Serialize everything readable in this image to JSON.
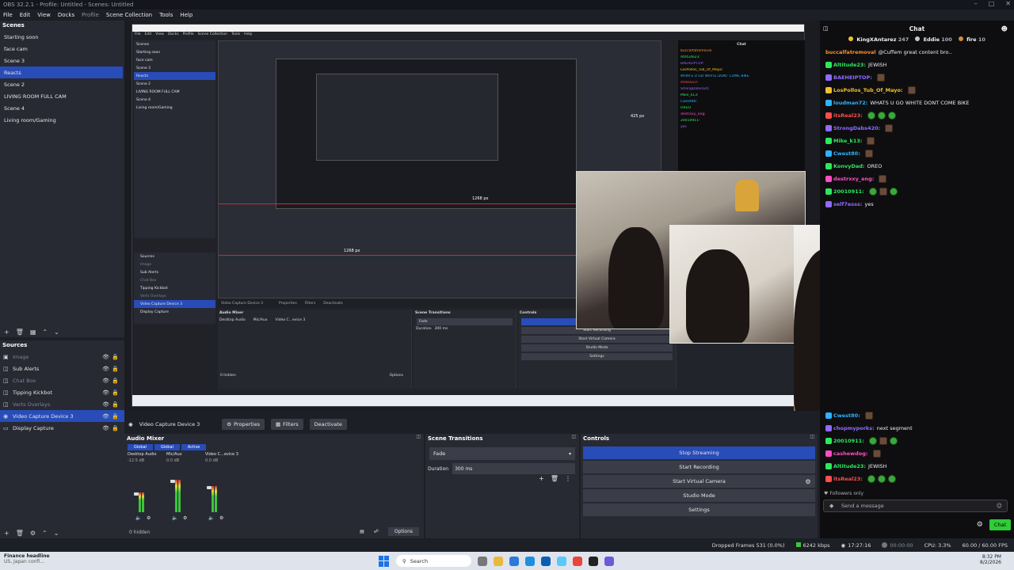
{
  "window": {
    "title": "OBS 32.2.1 - Profile: Untitled - Scenes: Untitled"
  },
  "menu": [
    {
      "label": "File",
      "dim": false
    },
    {
      "label": "Edit",
      "dim": false
    },
    {
      "label": "View",
      "dim": false
    },
    {
      "label": "Docks",
      "dim": false
    },
    {
      "label": "Profile",
      "dim": true
    },
    {
      "label": "Scene Collection",
      "dim": false
    },
    {
      "label": "Tools",
      "dim": false
    },
    {
      "label": "Help",
      "dim": false
    }
  ],
  "scenes": {
    "header": "Scenes",
    "items": [
      "Starting soon",
      "face cam",
      "Scene 3",
      "Reacts",
      "Scene 2",
      "LIVING ROOM FULL CAM",
      "Scene 4",
      "Living room/Gaming"
    ],
    "active_index": 3
  },
  "sources": {
    "header": "Sources",
    "items": [
      {
        "label": "Image",
        "icon": "image-icon",
        "dim": true
      },
      {
        "label": "Sub Alerts",
        "icon": "browser-icon",
        "dim": false
      },
      {
        "label": "Chat Box",
        "icon": "browser-icon",
        "dim": true
      },
      {
        "label": "Tipping Kickbot",
        "icon": "browser-icon",
        "dim": false
      },
      {
        "label": "Verts Overlays",
        "icon": "browser-icon",
        "dim": true
      },
      {
        "label": "Video Capture Device 3",
        "icon": "camera-icon",
        "dim": false,
        "active": true
      },
      {
        "label": "Display Capture",
        "icon": "monitor-icon",
        "dim": false
      }
    ]
  },
  "context_bar": {
    "source_name": "Video Capture Device 3",
    "properties": "Properties",
    "filters": "Filters",
    "deactivate": "Deactivate"
  },
  "mixer": {
    "header": "Audio Mixer",
    "tabs": [
      "Global",
      "Global",
      "Active"
    ],
    "channels": [
      "Desktop Audio",
      "Mic/Aux",
      "Video C...evice 3"
    ],
    "db": [
      "-12.5 dB",
      "0.0 dB",
      "0.0 dB"
    ],
    "levels": [
      0.45,
      0.75,
      0.6
    ],
    "hidden": "0 hidden",
    "options": "Options"
  },
  "transitions": {
    "header": "Scene Transitions",
    "selected": "Fade",
    "duration_label": "Duration",
    "duration_value": "300 ms"
  },
  "controls": {
    "header": "Controls",
    "buttons": [
      "Stop Streaming",
      "Start Recording",
      "Start Virtual Camera",
      "Studio Mode",
      "Settings"
    ]
  },
  "chat": {
    "header": "Chat",
    "top_user": "buccalfatremoval",
    "leaderboard": [
      {
        "name": "KingXAntarez",
        "score": "247",
        "color": "#f0c02b"
      },
      {
        "name": "Eddie",
        "score": "100",
        "color": "#c8c8c8"
      },
      {
        "name": "fire",
        "score": "10",
        "color": "#d48a3c"
      }
    ],
    "top_messages": [
      {
        "user": "buccalfatremoval",
        "color": "#ff8c29",
        "text": "@Cuffem great content bro..",
        "emotes": 0
      },
      {
        "user": "Altitude23:",
        "color": "#2ee85c",
        "text": "JEWISH",
        "emotes": 0
      },
      {
        "user": "BAEHEIPTOP:",
        "color": "#8f6bff",
        "text": "",
        "emotes": 1
      },
      {
        "user": "LosPollos_Tub_Of_Mayo:",
        "color": "#f0c02b",
        "text": "",
        "emotes": 1
      },
      {
        "user": "loudman72:",
        "color": "#2eb2ff",
        "text": "WHATS U GO WHITE DONT COME BIKE",
        "emotes": 0
      },
      {
        "user": "itsReal23:",
        "color": "#ff4d4d",
        "text": "",
        "emotes": 3
      },
      {
        "user": "StrongDabs420:",
        "color": "#8f6bff",
        "text": "",
        "emotes": 1
      },
      {
        "user": "Mike_k13:",
        "color": "#2ee85c",
        "text": "",
        "emotes": 1
      },
      {
        "user": "Cwest80:",
        "color": "#2eb2ff",
        "text": "",
        "emotes": 1
      },
      {
        "user": "KonvyDad:",
        "color": "#2ee85c",
        "text": "OREO",
        "emotes": 0
      },
      {
        "user": "destrxxy_eng:",
        "color": "#ff4dc4",
        "text": "",
        "emotes": 1
      },
      {
        "user": "20010911:",
        "color": "#2ee85c",
        "text": "",
        "emotes": 3
      },
      {
        "user": "self7esss:",
        "color": "#8f6bff",
        "text": "yes",
        "emotes": 0
      }
    ],
    "bottom_messages": [
      {
        "user": "Cwest80:",
        "color": "#2eb2ff",
        "text": "",
        "emotes": 1
      },
      {
        "user": "chopmyporks:",
        "color": "#8f6bff",
        "text": "next segment",
        "emotes": 0
      },
      {
        "user": "20010911:",
        "color": "#2ee85c",
        "text": "",
        "emotes": 3
      },
      {
        "user": "cashewdog:",
        "color": "#ff4dc4",
        "text": "",
        "emotes": 1
      },
      {
        "user": "Altitude23:",
        "color": "#2ee85c",
        "text": "JEWISH",
        "emotes": 0
      },
      {
        "user": "itsReal23:",
        "color": "#ff4d4d",
        "text": "",
        "emotes": 3
      }
    ],
    "followers_only": "Followers only",
    "input_placeholder": "Send a message",
    "chat_button": "Chat"
  },
  "status": {
    "dropped": "Dropped Frames 531 (0.0%)",
    "kbps": "6242 kbps",
    "live_time": "17:27:16",
    "rec_time": "00:00:00",
    "cpu": "CPU: 3.3%",
    "fps": "60.00 / 60.00 FPS"
  },
  "nested": {
    "px_label_1": "425 px",
    "px_label_2": "1268 px",
    "px_label_3": "1268 px"
  },
  "taskbar": {
    "news_title": "Finance headline",
    "news_sub": "US, Japan confi...",
    "search": "Search",
    "time": "8:32 PM",
    "date": "8/2/2026"
  },
  "colors": {
    "accent": "#284cb8",
    "panel": "#272a33",
    "chat_bg": "#0e0e10",
    "twitch_green": "#2ecc36"
  }
}
